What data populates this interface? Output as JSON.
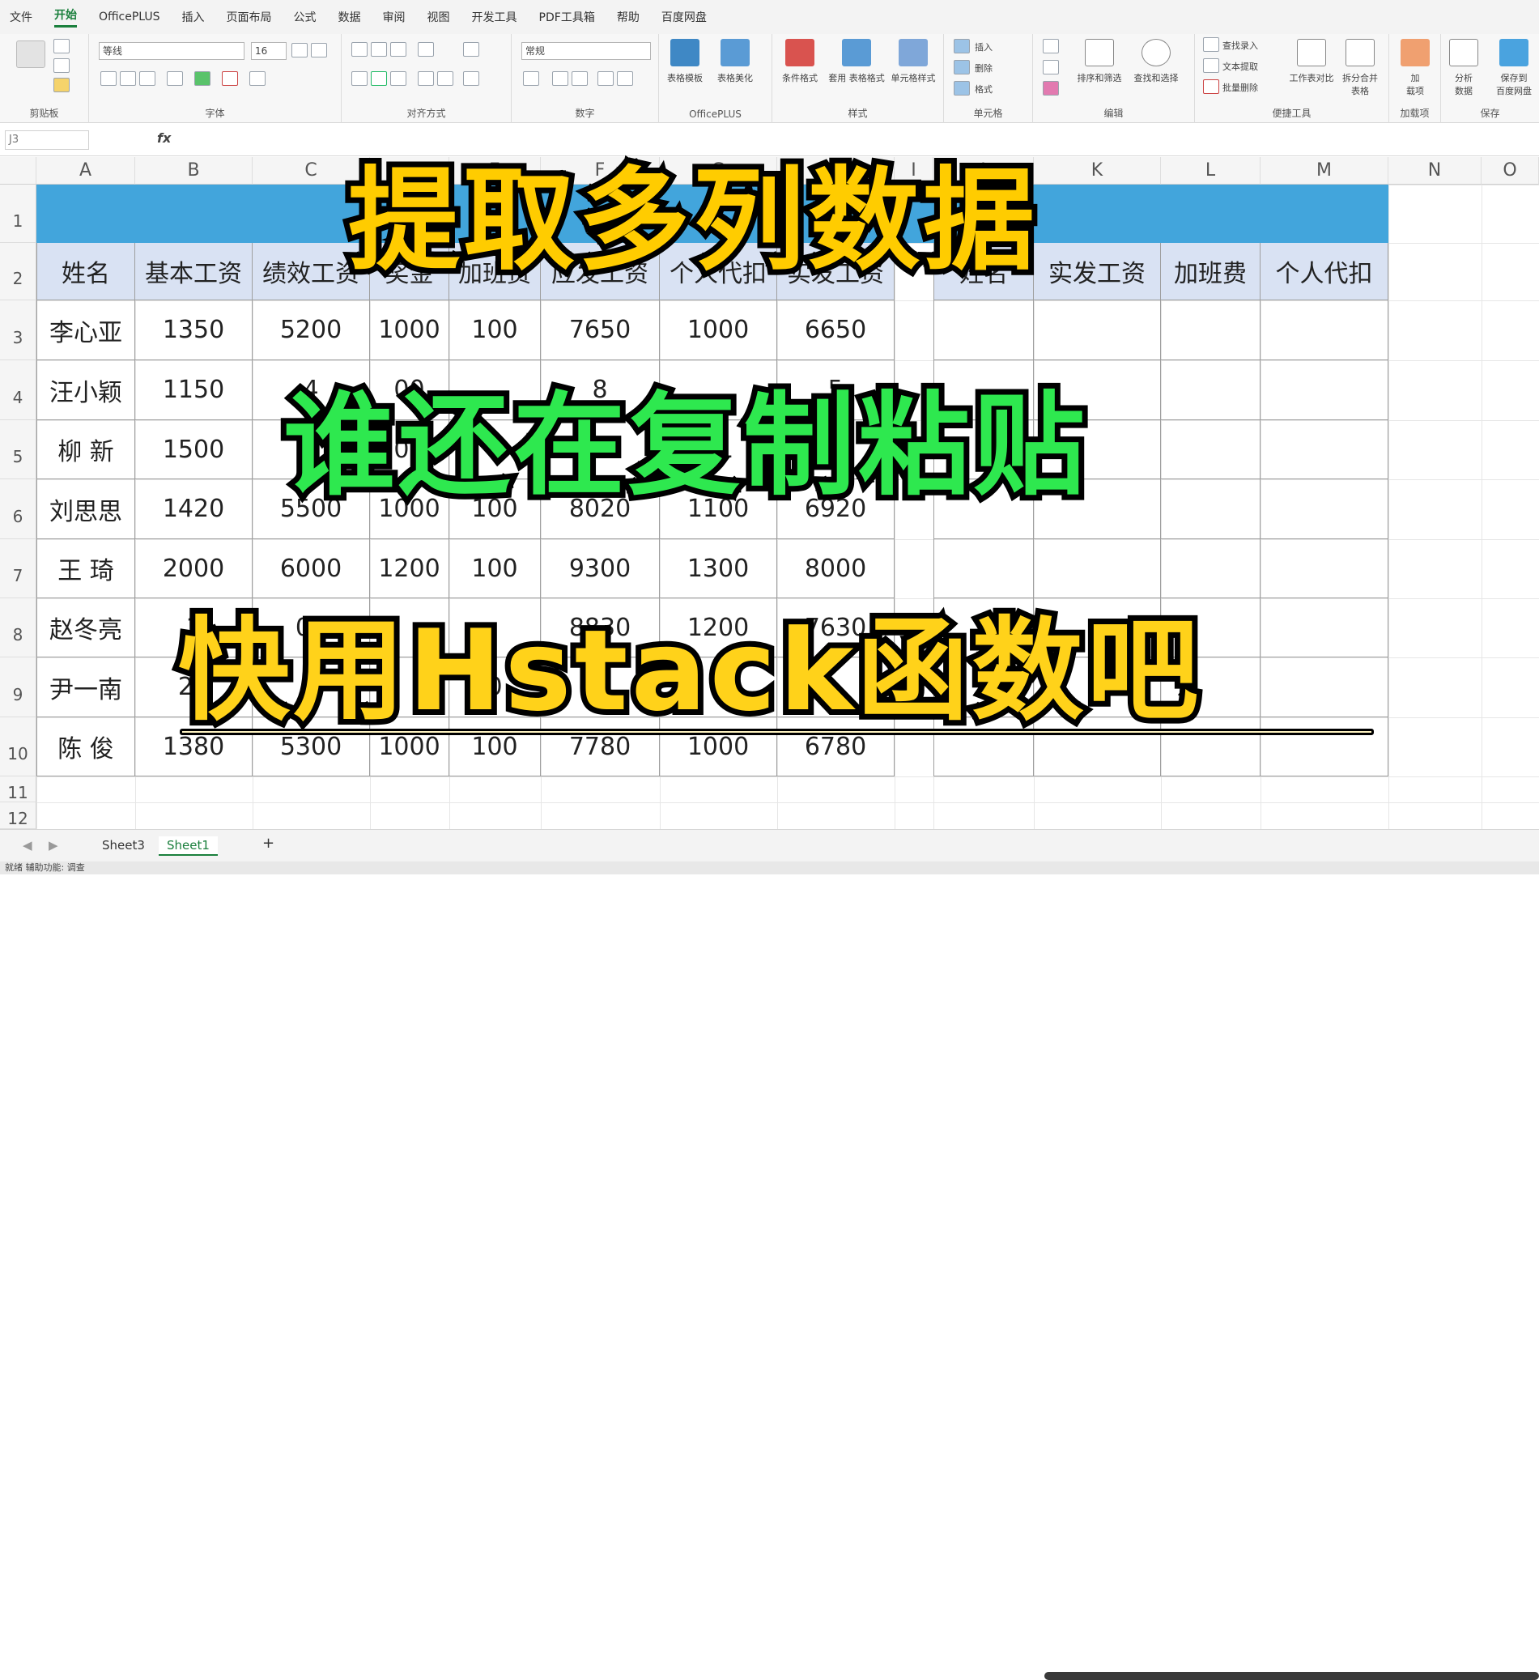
{
  "menu": [
    "文件",
    "开始",
    "OfficePLUS",
    "插入",
    "页面布局",
    "公式",
    "数据",
    "审阅",
    "视图",
    "开发工具",
    "PDF工具箱",
    "帮助",
    "百度网盘"
  ],
  "active_menu_index": 1,
  "ribbon": {
    "font_name": "等线",
    "font_size": "16",
    "number_format": "常规",
    "groups": [
      "剪贴板",
      "字体",
      "对齐方式",
      "数字",
      "OfficePLUS",
      "样式",
      "单元格",
      "编辑",
      "便捷工具",
      "加载项",
      "保存"
    ],
    "tools": {
      "table_template": "表格模板",
      "table_beautify": "表格美化",
      "conditional_format": "条件格式",
      "apply_table_format": "套用\n表格格式",
      "cell_style": "单元格样式",
      "insert": "插入",
      "delete": "删除",
      "format": "格式",
      "sort_filter": "排序和筛选",
      "find_select": "查找和选择",
      "find_entry": "查找录入",
      "text_extract": "文本提取",
      "batch_delete": "批量删除",
      "compare_sheets": "工作表对比",
      "split_merge": "拆分合并\n表格",
      "addins": "加\n载项",
      "analyze_data": "分析\n数据",
      "save_baidu": "保存到\n百度网盘"
    }
  },
  "formula_bar": {
    "name_box": "J3",
    "fx": "fx"
  },
  "columns": [
    "A",
    "B",
    "C",
    "D",
    "E",
    "F",
    "G",
    "H",
    "I",
    "J",
    "K",
    "L",
    "M",
    "N",
    "O"
  ],
  "rows": [
    "1",
    "2",
    "3",
    "4",
    "5",
    "6",
    "7",
    "8",
    "9",
    "10",
    "11",
    "12"
  ],
  "table_headers": [
    "姓名",
    "基本工资",
    "绩效工资",
    "奖金",
    "加班费",
    "应发工资",
    "个人代扣",
    "实发工资"
  ],
  "table_rows": [
    [
      "李心亚",
      "1350",
      "5200",
      "1000",
      "100",
      "7650",
      "1000",
      "6650"
    ],
    [
      "汪小颖",
      "1150",
      "4",
      "00",
      "",
      "8",
      "",
      "5"
    ],
    [
      "柳  新",
      "1500",
      "5",
      "00",
      "",
      "0",
      "11",
      "20"
    ],
    [
      "刘思思",
      "1420",
      "5500",
      "1000",
      "100",
      "8020",
      "1100",
      "6920"
    ],
    [
      "王  琦",
      "2000",
      "6000",
      "1200",
      "100",
      "9300",
      "1300",
      "8000"
    ],
    [
      "赵冬亮",
      "1",
      "00",
      "",
      "",
      "8830",
      "1200",
      "7630"
    ],
    [
      "尹一南",
      "21",
      "0",
      "",
      "0",
      "",
      "",
      ""
    ],
    [
      "陈  俊",
      "1380",
      "5300",
      "1000",
      "100",
      "7780",
      "1000",
      "6780"
    ]
  ],
  "right_headers": [
    "姓名",
    "实发工资",
    "加班费",
    "个人代扣"
  ],
  "overlay": {
    "line1": "提取多列数据",
    "line2": "谁还在复制粘贴",
    "line3": "快用Hstack函数吧"
  },
  "sheets": [
    "Sheet3",
    "Sheet1"
  ],
  "active_sheet": "Sheet1",
  "add_sheet": "+",
  "status_text": "就绪    辅助功能: 调查"
}
